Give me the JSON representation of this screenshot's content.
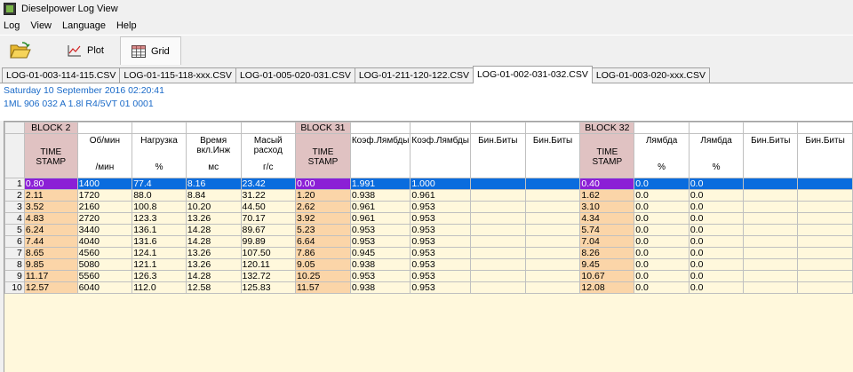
{
  "window": {
    "title": "Dieselpower Log View"
  },
  "menu": [
    "Log",
    "View",
    "Language",
    "Help"
  ],
  "toolbar": {
    "plot_label": "Plot",
    "grid_label": "Grid"
  },
  "tabs": [
    {
      "label": "LOG-01-003-114-115.CSV",
      "active": false
    },
    {
      "label": "LOG-01-115-118-xxx.CSV",
      "active": false
    },
    {
      "label": "LOG-01-005-020-031.CSV",
      "active": false
    },
    {
      "label": "LOG-01-211-120-122.CSV",
      "active": false
    },
    {
      "label": "LOG-01-002-031-032.CSV",
      "active": true
    },
    {
      "label": "LOG-01-003-020-xxx.CSV",
      "active": false
    }
  ],
  "info": {
    "date": "Saturday 10 September 2016 02:20:41",
    "ecu": "1ML 906 032 A  1.8l R4/5VT     01 0001"
  },
  "grid": {
    "blocks": [
      "BLOCK 2",
      "BLOCK 31",
      "BLOCK 32"
    ],
    "headers": [
      {
        "l1": "TIME",
        "l2": "STAMP",
        "unit": ""
      },
      {
        "l1": "Об/мин",
        "l2": "",
        "unit": "/мин"
      },
      {
        "l1": "Нагрузка",
        "l2": "",
        "unit": "%"
      },
      {
        "l1": "Время",
        "l2": "вкл.Инж",
        "unit": "мс"
      },
      {
        "l1": "Масый",
        "l2": "расход",
        "unit": "г/с"
      },
      {
        "l1": "TIME",
        "l2": "STAMP",
        "unit": ""
      },
      {
        "l1": "Коэф.Лямбды",
        "l2": "",
        "unit": ""
      },
      {
        "l1": "Коэф.Лямбды",
        "l2": "",
        "unit": ""
      },
      {
        "l1": "Бин.Биты",
        "l2": "",
        "unit": ""
      },
      {
        "l1": "Бин.Биты",
        "l2": "",
        "unit": ""
      },
      {
        "l1": "TIME",
        "l2": "STAMP",
        "unit": ""
      },
      {
        "l1": "Лямбда",
        "l2": "",
        "unit": "%"
      },
      {
        "l1": "Лямбда",
        "l2": "",
        "unit": "%"
      },
      {
        "l1": "Бин.Биты",
        "l2": "",
        "unit": ""
      },
      {
        "l1": "Бин.Биты",
        "l2": "",
        "unit": ""
      }
    ],
    "rows": [
      {
        "n": "1",
        "c": [
          "0.80",
          "1400",
          "77.4",
          "8.16",
          "23.42",
          "0.00",
          "1.991",
          "1.000",
          "",
          "",
          "0.40",
          "0.0",
          "0.0",
          "",
          ""
        ]
      },
      {
        "n": "2",
        "c": [
          "2.11",
          "1720",
          "88.0",
          "8.84",
          "31.22",
          "1.20",
          "0.938",
          "0.961",
          "",
          "",
          "1.62",
          "0.0",
          "0.0",
          "",
          ""
        ]
      },
      {
        "n": "3",
        "c": [
          "3.52",
          "2160",
          "100.8",
          "10.20",
          "44.50",
          "2.62",
          "0.961",
          "0.953",
          "",
          "",
          "3.10",
          "0.0",
          "0.0",
          "",
          ""
        ]
      },
      {
        "n": "4",
        "c": [
          "4.83",
          "2720",
          "123.3",
          "13.26",
          "70.17",
          "3.92",
          "0.961",
          "0.953",
          "",
          "",
          "4.34",
          "0.0",
          "0.0",
          "",
          ""
        ]
      },
      {
        "n": "5",
        "c": [
          "6.24",
          "3440",
          "136.1",
          "14.28",
          "89.67",
          "5.23",
          "0.953",
          "0.953",
          "",
          "",
          "5.74",
          "0.0",
          "0.0",
          "",
          ""
        ]
      },
      {
        "n": "6",
        "c": [
          "7.44",
          "4040",
          "131.6",
          "14.28",
          "99.89",
          "6.64",
          "0.953",
          "0.953",
          "",
          "",
          "7.04",
          "0.0",
          "0.0",
          "",
          ""
        ]
      },
      {
        "n": "7",
        "c": [
          "8.65",
          "4560",
          "124.1",
          "13.26",
          "107.50",
          "7.86",
          "0.945",
          "0.953",
          "",
          "",
          "8.26",
          "0.0",
          "0.0",
          "",
          ""
        ]
      },
      {
        "n": "8",
        "c": [
          "9.85",
          "5080",
          "121.1",
          "13.26",
          "120.11",
          "9.05",
          "0.938",
          "0.953",
          "",
          "",
          "9.45",
          "0.0",
          "0.0",
          "",
          ""
        ]
      },
      {
        "n": "9",
        "c": [
          "11.17",
          "5560",
          "126.3",
          "14.28",
          "132.72",
          "10.25",
          "0.953",
          "0.953",
          "",
          "",
          "10.67",
          "0.0",
          "0.0",
          "",
          ""
        ]
      },
      {
        "n": "10",
        "c": [
          "12.57",
          "6040",
          "112.0",
          "12.58",
          "125.83",
          "11.57",
          "0.938",
          "0.953",
          "",
          "",
          "12.08",
          "0.0",
          "0.0",
          "",
          ""
        ]
      }
    ],
    "selected_row": 0
  }
}
